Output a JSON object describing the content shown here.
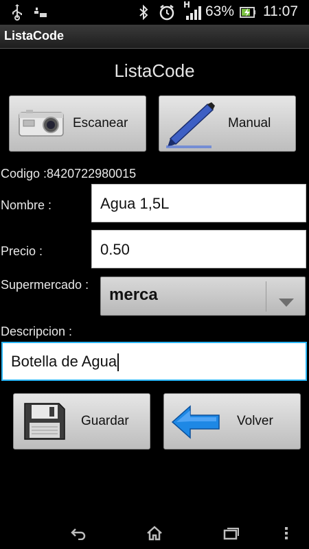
{
  "status_bar": {
    "battery_percent": "63%",
    "time": "11:07",
    "network_type": "H",
    "icons": [
      "usb-icon",
      "signal-bars-icon",
      "bluetooth-icon",
      "alarm-icon",
      "cell-signal-icon",
      "battery-charging-icon"
    ]
  },
  "app": {
    "window_title": "ListaCode",
    "header": "ListaCode"
  },
  "scan_buttons": {
    "scan_label": "Escanear",
    "manual_label": "Manual"
  },
  "form": {
    "codigo_label": "Codigo :",
    "codigo_value": "8420722980015",
    "nombre_label": "Nombre :",
    "nombre_value": "Agua 1,5L",
    "precio_label": "Precio :",
    "precio_value": "0.50",
    "supermercado_label": "Supermercado :",
    "supermercado_value": "merca",
    "descripcion_label": "Descripcion :",
    "descripcion_value": "Botella de Agua"
  },
  "actions": {
    "save_label": "Guardar",
    "back_label": "Volver"
  },
  "nav": {
    "icons": [
      "back-nav-icon",
      "home-nav-icon",
      "recent-apps-icon",
      "overflow-menu-icon"
    ]
  },
  "colors": {
    "background": "#000000",
    "focus_border": "#29b6f6",
    "battery": "#7cc242",
    "arrow": "#1e88e5"
  }
}
